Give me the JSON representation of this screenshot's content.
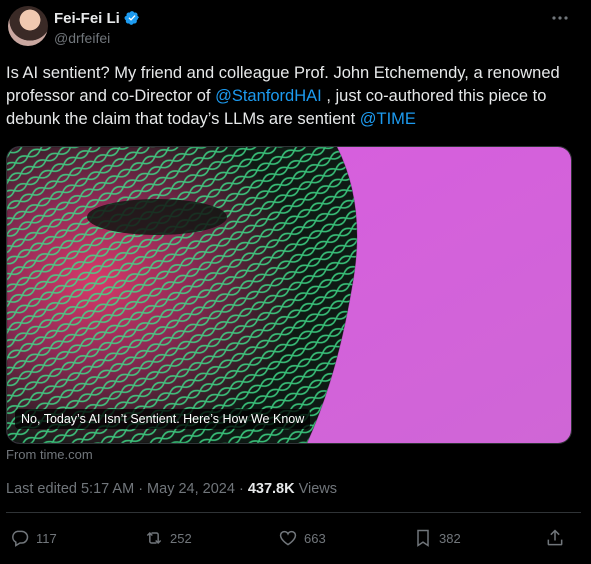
{
  "author": {
    "name": "Fei-Fei Li",
    "handle": "@drfeifei",
    "verified_icon": "verified-badge-icon"
  },
  "tweet": {
    "text_part1": "Is AI sentient? My friend and colleague Prof. John Etchemendy, a renowned professor and co-Director of ",
    "mention1": "@StanfordHAI",
    "text_part2": " , just co-authored this piece to debunk the claim that today’s LLMs are sentient ",
    "mention2": "@TIME"
  },
  "card": {
    "caption": "No, Today’s AI Isn’t Sentient. Here’s How We Know",
    "source": "From time.com"
  },
  "meta": {
    "edited": "Last edited 5:17 AM · May 24, 2024 · ",
    "views_count": "437.8K",
    "views_label": " Views"
  },
  "actions": {
    "replies": "117",
    "reposts": "252",
    "likes": "663",
    "bookmarks": "382"
  },
  "colors": {
    "background": "#000000",
    "text": "#e7e9ea",
    "muted": "#71767b",
    "accent": "#1d9bf0"
  }
}
